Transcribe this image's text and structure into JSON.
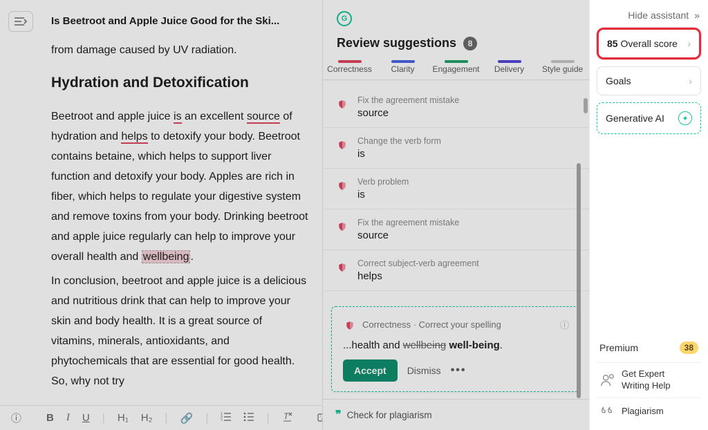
{
  "editor": {
    "doc_title": "Is Beetroot and Apple Juice Good for the Ski...",
    "line_before": "from damage caused by UV radiation.",
    "heading": "Hydration and Detoxification",
    "p1_pre": "Beetroot and apple juice ",
    "p1_err1": "is",
    "p1_mid1": " an excellent ",
    "p1_err2": "source",
    "p1_mid2": " of hydration and ",
    "p1_err3": "helps",
    "p1_tail": " to detoxify your body. Beetroot contains betaine, which helps to support liver function and detoxify your body. Apples are rich in fiber, which helps to regulate your digestive system and remove toxins from your body. Drinking beetroot and apple juice regularly can help to improve your overall health and ",
    "p1_hl": "wellbeing",
    "p1_end": ".",
    "p2": "In conclusion, beetroot and apple juice is a delicious and nutritious drink that can help to improve your skin and body health. It is a great source of vitamins, minerals, antioxidants, and phytochemicals that are essential for good health. So, why not try",
    "toolbar": {
      "b": "B",
      "i": "I",
      "u": "U",
      "h1": "H₁",
      "h2": "H₂"
    }
  },
  "review": {
    "title": "Review suggestions",
    "count": "8",
    "tabs": {
      "correctness": "Correctness",
      "clarity": "Clarity",
      "engagement": "Engagement",
      "delivery": "Delivery",
      "style": "Style guide"
    },
    "tab_colors": {
      "correctness": "#e0455f",
      "clarity": "#4b62e3",
      "engagement": "#1fa36c",
      "delivery": "#5546d7",
      "style": "#c5c5c5"
    },
    "items": [
      {
        "meta": "Fix the agreement mistake",
        "word": "source"
      },
      {
        "meta": "Change the verb form",
        "word": "is"
      },
      {
        "meta": "Verb problem",
        "word": "is"
      },
      {
        "meta": "Fix the agreement mistake",
        "word": "source"
      },
      {
        "meta": "Correct subject-verb agreement",
        "word": "helps"
      }
    ],
    "expanded": {
      "breadcrumb": "Correctness · Correct your spelling",
      "context_pre": "...health and ",
      "context_old": "wellbeing",
      "context_new": "well-being",
      "context_end": ".",
      "accept": "Accept",
      "dismiss": "Dismiss"
    },
    "plagiarism": "Check for plagiarism"
  },
  "sidebar": {
    "hide": "Hide assistant",
    "score_num": "85",
    "score_label": " Overall score",
    "goals": "Goals",
    "gen_ai": "Generative AI",
    "premium": {
      "title": "Premium",
      "badge": "38",
      "item1": "Get Expert\nWriting Help",
      "item2": "Plagiarism"
    }
  }
}
